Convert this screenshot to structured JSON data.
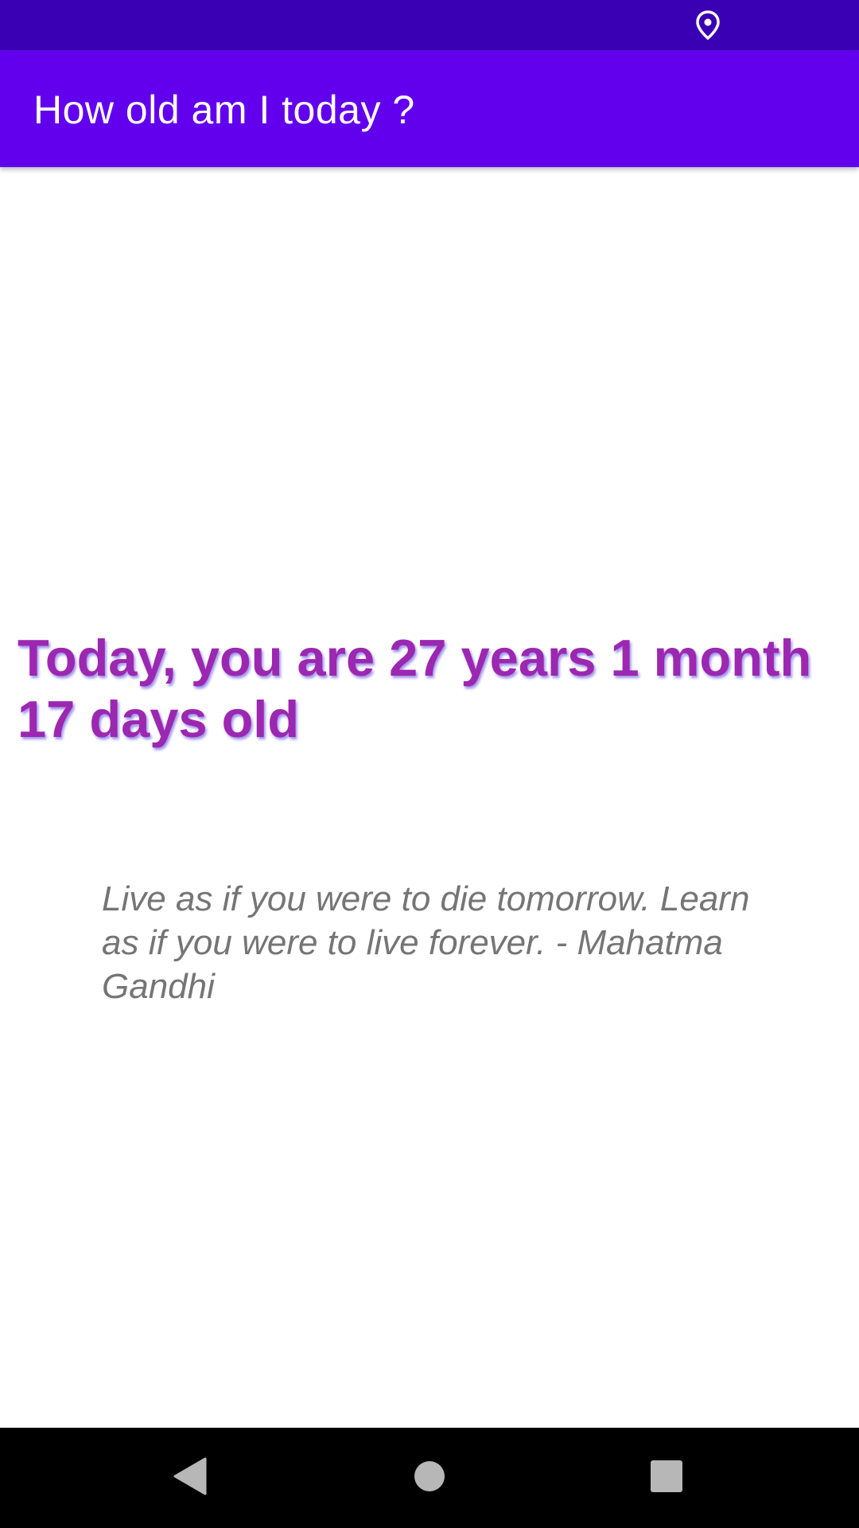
{
  "status_bar": {
    "icons": [
      "location-icon"
    ]
  },
  "app_bar": {
    "title": "How old am I today ?"
  },
  "main": {
    "age_message": "Today, you are 27 years 1 month 17 days old",
    "quote": "Live as if you were to die tomorrow. Learn as if you were to live forever.  - Mahatma Gandhi"
  },
  "nav_bar": {
    "buttons": [
      "back-icon",
      "home-icon",
      "recents-icon"
    ]
  },
  "colors": {
    "status_bar": "#3a00b3",
    "app_bar": "#6200ee",
    "age_text": "#9c27b0",
    "quote_text": "#757575",
    "nav_bar": "#000000"
  }
}
